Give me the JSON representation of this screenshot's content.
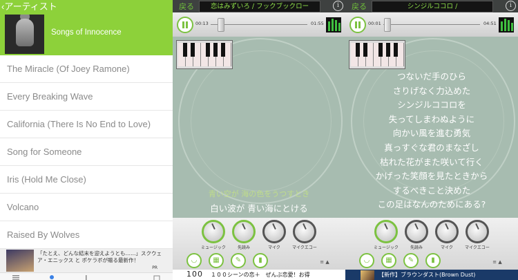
{
  "left": {
    "back_label": "アーティスト",
    "album_title": "Songs of Innocence",
    "songs": [
      "The Miracle (Of Joey Ramone)",
      "Every Breaking Wave",
      "California (There Is No End to Love)",
      "Song for Someone",
      "Iris (Hold Me Close)",
      "Volcano",
      "Raised By Wolves"
    ],
    "ad": {
      "text": "「たとえ、どんな結末を迎えようとも……」スクウェア・エニックス と ポケラボが贈る最新作！",
      "pr": "PR"
    }
  },
  "mid": {
    "back_label": "戻る",
    "song_title": "恋はみずいろ / フックブックロー",
    "time_elapsed": "00:13",
    "time_total": "01:55",
    "seek_fraction": 0.07,
    "lyric_faint": "青い空が 海の色をうつすとき",
    "lyric_main": "白い波が 青い海にとける",
    "dials": [
      "ミュージック",
      "先読み",
      "マイク",
      "マイクエコー"
    ],
    "ad": {
      "logo": "100",
      "text": "１００シーンの恋＋　ぜんぶ恋愛！お得"
    }
  },
  "right": {
    "back_label": "戻る",
    "song_title": "シンジルココロ /",
    "time_elapsed": "00:01",
    "time_total": "04:51",
    "seek_fraction": 0.01,
    "lyrics": [
      "つないだ手のひら",
      "さりげなく力込めた",
      "シンジルココロを",
      "失ってしまわぬように",
      "向かい風を進む勇気",
      "真っすぐな君のまなざし",
      "枯れた花がまた咲いて行く",
      "かげった笑顔を見たときから",
      "するべきこと決めた",
      "この足はなんのためにある?"
    ],
    "dials": [
      "ミュージック",
      "先読み",
      "マイク",
      "マイクエコー"
    ],
    "ad": {
      "text": "【新作】ブラウンダスト(Brown Dust)"
    }
  },
  "colors": {
    "accent": "#8dd13a",
    "stage": "#a7bcb0",
    "title_bar": "#141414",
    "title_text": "#8fe04a"
  },
  "icons": [
    "back-chevron-icon",
    "pause-icon",
    "info-icon",
    "piano-icon",
    "level-meter-icon",
    "mouth-icon",
    "score-icon",
    "pencil-icon",
    "mic-icon",
    "eject-icon"
  ]
}
